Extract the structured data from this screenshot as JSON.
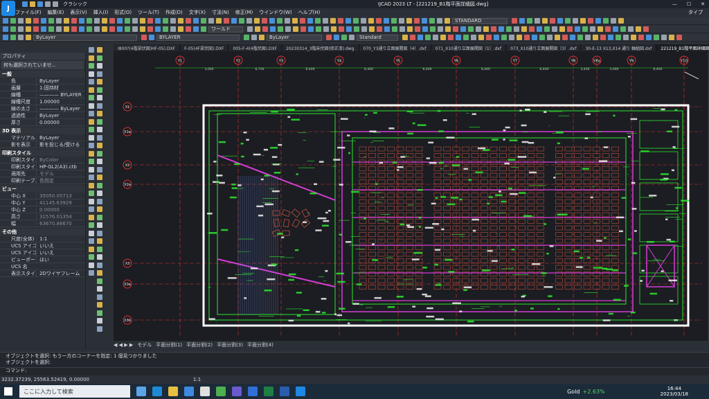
{
  "window": {
    "title": "IJCAD 2023 LT - [221219_B1階平面詳細図.dwg]",
    "workspace": "クラシック",
    "search_label": "タイプ"
  },
  "menu": [
    "ファイル(F)",
    "編集(E)",
    "表示(V)",
    "挿入(I)",
    "形式(O)",
    "ツール(T)",
    "作成(D)",
    "文字(X)",
    "寸法(N)",
    "修正(M)",
    "ウインドウ(W)",
    "ヘルプ(H)"
  ],
  "toolbar": {
    "view_combo": "ワールド",
    "style_combo": "STANDARD",
    "layer_combo": "ByLayer",
    "layer2": "BYLAYER",
    "linetype": "ByLayer",
    "textstyle": "Standard"
  },
  "properties": {
    "title": "プロパティ",
    "selection": "何も選択されていませ...",
    "sections": [
      {
        "name": "一般",
        "rows": [
          [
            "色",
            "ByLayer",
            false
          ],
          [
            "画層",
            "1:固持材",
            false
          ],
          [
            "線種",
            "———— BYLAYER",
            false
          ],
          [
            "線種尺度",
            "1.00000",
            false
          ],
          [
            "線の太さ",
            "———— ByLayer",
            false
          ],
          [
            "透過性",
            "ByLayer",
            false
          ],
          [
            "厚さ",
            "0.00000",
            false
          ]
        ]
      },
      {
        "name": "3D 表示",
        "rows": [
          [
            "マテリアル",
            "ByLayer",
            false
          ],
          [
            "影を表示",
            "影を投じる/受ける",
            false
          ]
        ]
      },
      {
        "name": "印刷スタイル",
        "rows": [
          [
            "印刷スタイル",
            "ByColor",
            true
          ],
          [
            "印刷スタイル",
            "HP-GL2(A3).ctb",
            false
          ],
          [
            "適用先",
            "モデル",
            true
          ],
          [
            "印刷テーブル...",
            "色指定",
            true
          ]
        ]
      },
      {
        "name": "ビュー",
        "rows": [
          [
            "中心 X",
            "35050.05713",
            true
          ],
          [
            "中心 Y",
            "41145.63929",
            true
          ],
          [
            "中心 Z",
            "0.00000",
            true
          ],
          [
            "高さ",
            "31576.01354",
            true
          ],
          [
            "幅",
            "63670.86670",
            true
          ]
        ]
      },
      {
        "name": "その他",
        "rows": [
          [
            "尺度(全体)",
            "1:1",
            false
          ],
          [
            "UCS アイコン...",
            "いいえ",
            false
          ],
          [
            "UCS アイコン...",
            "いいえ",
            false
          ],
          [
            "ビューポートご...",
            "はい",
            false
          ],
          [
            "UCS 名",
            "",
            false
          ],
          [
            "表示スタイル",
            "2Dワイヤフレーム",
            false
          ]
        ]
      }
    ]
  },
  "doc_tabs": [
    "I800?(4階梁伏図)HF-05).DXF",
    "F-05(4F梁伏図).DXF",
    "005-F-4(4階伏図).DXF",
    "20230314_3階床伏図(修正済).dwg",
    "070_Y3通り立面展開図（4）.dxf",
    "071_X10通り立面展開図（1）.dxf",
    "073_X10通り立面展開図（3）.dxf",
    "30-E-13 X13,X14 通り 軸組図.dxf",
    "221219_B1階平面詳細図"
  ],
  "layout_tabs": [
    "モデル",
    "平面分割(1)",
    "平面分割(2)",
    "平面分割(3)",
    "平面分割(4)"
  ],
  "grid_top": [
    "Y1",
    "Y2",
    "Y3",
    "Y4",
    "Y5",
    "Y6",
    "Y7",
    "Y8",
    "Y8a",
    "Y9",
    "Y10"
  ],
  "grid_dims": [
    "3,000",
    "6,750",
    "6,400",
    "6,400",
    "6,400",
    "6,400",
    "6,400",
    "3,400",
    "3,000",
    "6,400"
  ],
  "grid_left": [
    "X1",
    "X1a",
    "X2",
    "X2a",
    "X3",
    "X3a",
    "X3b",
    "X4"
  ],
  "command": {
    "line1": "オブジェクトを選択:  もう一方のコーナーを指定:  1  個見つかりました",
    "line2": "オブジェクトを選択:",
    "prompt": "コマンド:"
  },
  "status": {
    "coords": "3232.37239, 25563.52419, 0.00000",
    "scale": "1:1"
  },
  "taskbar": {
    "search": "ここに入力して検索",
    "stock": "Gold",
    "change": "+2.63%",
    "time": "16:44",
    "date": "2023/03/18"
  },
  "colors": {
    "canvas": "#1b1d22",
    "grid": "#e03030",
    "wall": "#ffffff",
    "green": "#2ee82e",
    "magenta": "#d83cd8",
    "seats": "#c0503c"
  }
}
